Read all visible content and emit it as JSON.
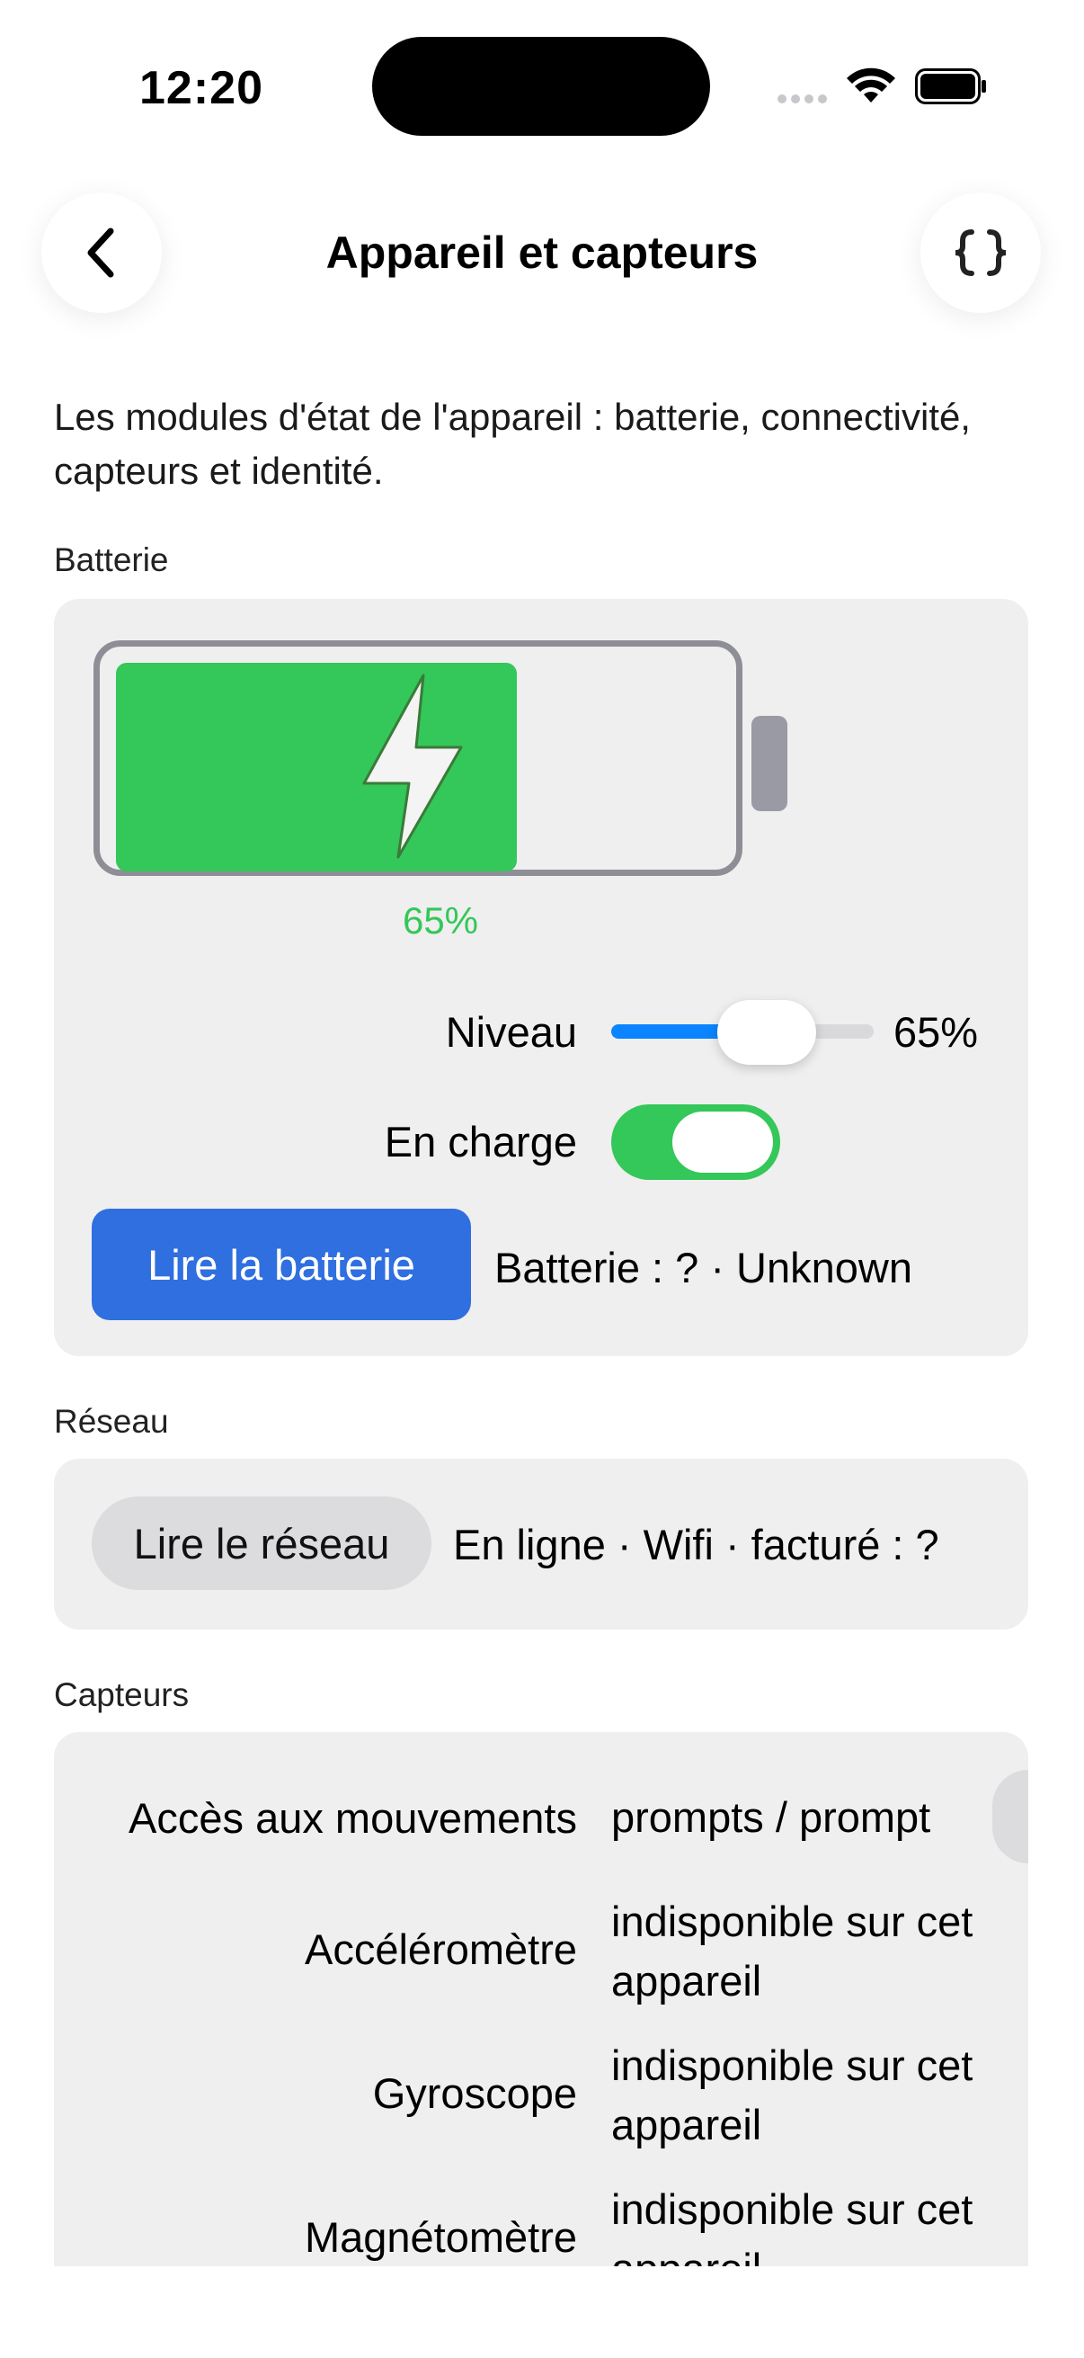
{
  "status_bar": {
    "time": "12:20"
  },
  "nav": {
    "title": "Appareil et capteurs",
    "back_icon": "chevron-left-icon",
    "code_icon": "curly-braces-icon"
  },
  "intro": "Les modules d'état de l'appareil : batterie, connectivité, capteurs et identité.",
  "battery": {
    "section_label": "Batterie",
    "level_percent_label": "65%",
    "level_value": 0.65,
    "charging": true,
    "level_row_label": "Niveau",
    "level_slider_value": "65%",
    "charging_row_label": "En charge",
    "read_button": "Lire la batterie",
    "status": "Batterie : ? · Unknown",
    "fill_color": "#34c759",
    "button_color": "#2f6fe0"
  },
  "network": {
    "section_label": "Réseau",
    "read_button": "Lire le réseau",
    "status": "En ligne · Wifi · facturé : ?"
  },
  "sensors": {
    "section_label": "Capteurs",
    "rows": [
      {
        "label": "Accès aux mouvements",
        "value": "prompts / prompt"
      },
      {
        "label": "Accéléromètre",
        "value": "indisponible sur cet appareil"
      },
      {
        "label": "Gyroscope",
        "value": "indisponible sur cet appareil"
      },
      {
        "label": "Magnétomètre",
        "value": "indisponible sur cet appareil"
      }
    ]
  }
}
